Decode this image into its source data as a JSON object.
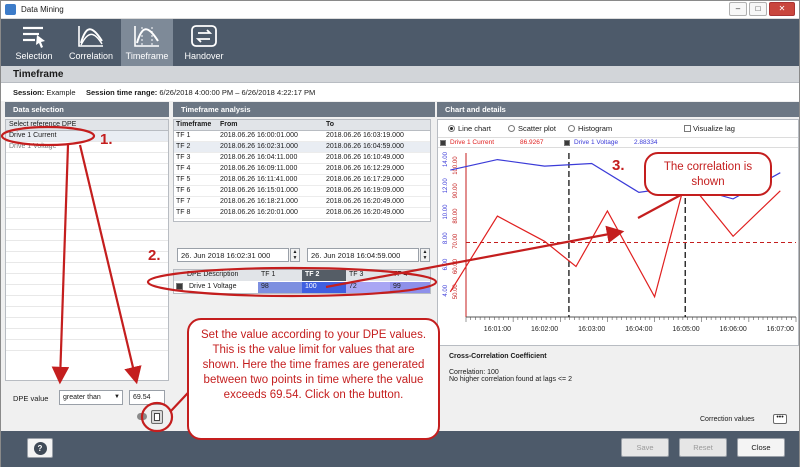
{
  "window": {
    "title": "Data Mining"
  },
  "toolbar": {
    "items": [
      {
        "label": "Selection"
      },
      {
        "label": "Correlation"
      },
      {
        "label": "Timeframe"
      },
      {
        "label": "Handover"
      }
    ]
  },
  "section": {
    "title": "Timeframe"
  },
  "session": {
    "session_label": "Session:",
    "session_value": "Example",
    "range_label": "Session time range:",
    "range_value": "6/26/2018 4:00:00 PM – 6/26/2018 4:22:17 PM"
  },
  "data_selection": {
    "header": "Data selection",
    "list_header": "Select reference DPE",
    "items": [
      "Drive 1 Current",
      "Drive 1 Voltage"
    ],
    "dpe_value_label": "DPE value",
    "comparison": "greater than",
    "value": "69.54"
  },
  "timeframe_analysis": {
    "header": "Timeframe analysis",
    "columns": [
      "Timeframe",
      "From",
      "To"
    ],
    "rows": [
      {
        "tf": "TF 1",
        "from": "2018.06.26 16:00:01.000",
        "to": "2018.06.26 16:03:19.000"
      },
      {
        "tf": "TF 2",
        "from": "2018.06.26 16:02:31.000",
        "to": "2018.06.26 16:04:59.000"
      },
      {
        "tf": "TF 3",
        "from": "2018.06.26 16:04:11.000",
        "to": "2018.06.26 16:10:49.000"
      },
      {
        "tf": "TF 4",
        "from": "2018.06.26 16:09:11.000",
        "to": "2018.06.26 16:12:29.000"
      },
      {
        "tf": "TF 5",
        "from": "2018.06.26 16:11:41.000",
        "to": "2018.06.26 16:17:29.000"
      },
      {
        "tf": "TF 6",
        "from": "2018.06.26 16:15:01.000",
        "to": "2018.06.26 16:19:09.000"
      },
      {
        "tf": "TF 7",
        "from": "2018.06.26 16:18:21.000",
        "to": "2018.06.26 16:20:49.000"
      },
      {
        "tf": "TF 8",
        "from": "2018.06.26 16:20:01.000",
        "to": "2018.06.26 16:20:49.000"
      }
    ],
    "from_input": "26. Jun 2018 16:02:31 000",
    "to_input": "26. Jun 2018 16:04:59.000",
    "dpe_grid": {
      "headers": [
        "DPE Description",
        "TF 1",
        "TF 2",
        "TF 3",
        "TF 4"
      ],
      "row": {
        "name": "Drive 1 Voltage",
        "values": [
          "98",
          "100",
          "72",
          "99"
        ]
      }
    }
  },
  "chart_details": {
    "header": "Chart and details",
    "modes": [
      "Line chart",
      "Scatter plot",
      "Histogram"
    ],
    "selected_mode": "Line chart",
    "visualize_lag": "Visualize lag",
    "legend": [
      {
        "name": "Drive 1 Current",
        "value": "86.9267",
        "color": "#e02020"
      },
      {
        "name": "Drive 1 Voltage",
        "value": "2.88334",
        "color": "#3b3bd8"
      }
    ],
    "cc_title": "Cross-Correlation Coefficient",
    "cc_line1": "Correlation: 100",
    "cc_line2": "No higher correlation found at lags <= 2",
    "correction_values": "Correction values"
  },
  "chart_data": {
    "type": "line",
    "x_ticks": [
      "16:01:00",
      "16:02:00",
      "16:03:00",
      "16:04:00",
      "16:05:00",
      "16:06:00",
      "16:07:00"
    ],
    "left_ticks": [
      "4.00",
      "6.00",
      "8.00",
      "10.00",
      "12.00",
      "14.00"
    ],
    "right_ticks": [
      "50.00",
      "60.00",
      "70.00",
      "80.00",
      "90.00",
      "100.00"
    ],
    "series": [
      {
        "name": "Drive 1 Current",
        "color": "#e02020",
        "x": [
          "16:00:00",
          "16:01:00",
          "16:02:00",
          "16:02:40",
          "16:03:20",
          "16:04:20",
          "16:05:00",
          "16:06:00",
          "16:07:00"
        ],
        "values": [
          50,
          80,
          70,
          60,
          82,
          48,
          95,
          72,
          90
        ]
      },
      {
        "name": "Drive 1 Voltage",
        "color": "#3b3bd8",
        "x": [
          "16:00:00",
          "16:01:00",
          "16:02:00",
          "16:03:00",
          "16:04:00",
          "16:05:00",
          "16:06:00",
          "16:07:00"
        ],
        "values": [
          13.2,
          14.0,
          13.5,
          13.7,
          11.5,
          12.0,
          11.0,
          13.0
        ]
      }
    ],
    "threshold": 69.54
  },
  "buttons": {
    "save": "Save",
    "reset": "Reset",
    "close": "Close",
    "help": "?"
  },
  "annotations": {
    "num1": "1.",
    "num2": "2.",
    "num3": "3.",
    "callout_correlation": "The correlation is shown",
    "callout_value": "Set the value according to your DPE values. This is the value limit for values that are shown. Here the time frames are generated between two points in time where the value exceeds 69.54. Click on the button."
  }
}
